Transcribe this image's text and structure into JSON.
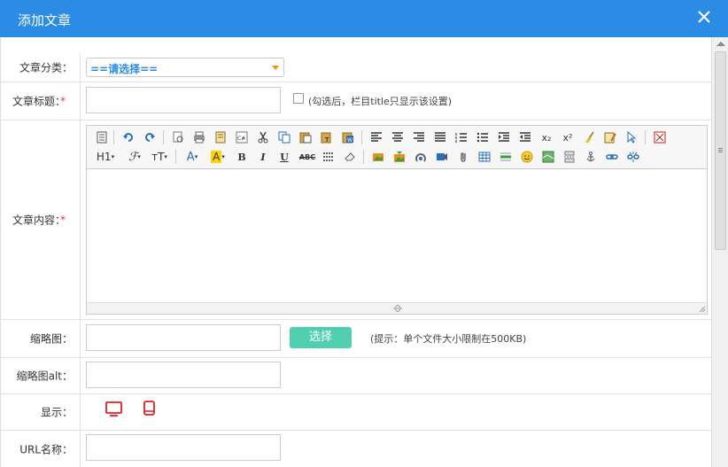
{
  "dialog": {
    "title": "添加文章"
  },
  "form": {
    "category": {
      "label": "文章分类：",
      "selected": "==请选择=="
    },
    "article_title": {
      "label": "文章标题：",
      "required_mark": "*",
      "value": "",
      "checkbox_hint": "(勾选后，栏目title只显示该设置)"
    },
    "content": {
      "label": "文章内容：",
      "required_mark": "*"
    },
    "thumbnail": {
      "label": "缩略图：",
      "value": "",
      "button_label": "选择",
      "hint": "(提示：单个文件大小限制在500KB)"
    },
    "thumbnail_alt": {
      "label": "缩略图alt：",
      "value": ""
    },
    "display": {
      "label": "显示：",
      "icons": [
        "desktop-icon",
        "mobile-icon"
      ],
      "icon_color": "#e02020"
    },
    "url_name": {
      "label": "URL名称：",
      "value": ""
    }
  },
  "editor_toolbar": {
    "row1": [
      "source-icon",
      "undo-icon",
      "redo-icon",
      "preview-icon",
      "print-icon",
      "template-icon",
      "code-icon",
      "cut-icon",
      "copy-icon",
      "paste-icon",
      "paste-text-icon",
      "paste-word-icon",
      "align-left-icon",
      "align-center-icon",
      "align-right-icon",
      "justify-icon",
      "ordered-list-icon",
      "unordered-list-icon",
      "indent-icon",
      "outdent-icon",
      "subscript-icon",
      "superscript-icon",
      "clear-format-icon",
      "quick-format-icon",
      "select-all-icon",
      "fullscreen-icon"
    ],
    "row2": [
      "heading-icon",
      "font-family-icon",
      "font-size-icon",
      "font-color-icon",
      "highlight-icon",
      "bold-icon",
      "italic-icon",
      "underline-icon",
      "strikethrough-icon",
      "line-height-icon",
      "remove-format-icon",
      "image-icon",
      "multi-image-icon",
      "flash-icon",
      "media-icon",
      "attachment-icon",
      "table-icon",
      "hr-icon",
      "emoticon-icon",
      "map-icon",
      "pagebreak-icon",
      "anchor-icon",
      "link-icon",
      "unlink-icon"
    ],
    "heading_label": "H1",
    "font_size_label": "тT",
    "font_color_label": "A",
    "highlight_label": "A",
    "bold_label": "B",
    "italic_label": "I",
    "underline_label": "U",
    "strike_label": "ABC",
    "sub_label": "x₂",
    "sup_label": "x²"
  }
}
